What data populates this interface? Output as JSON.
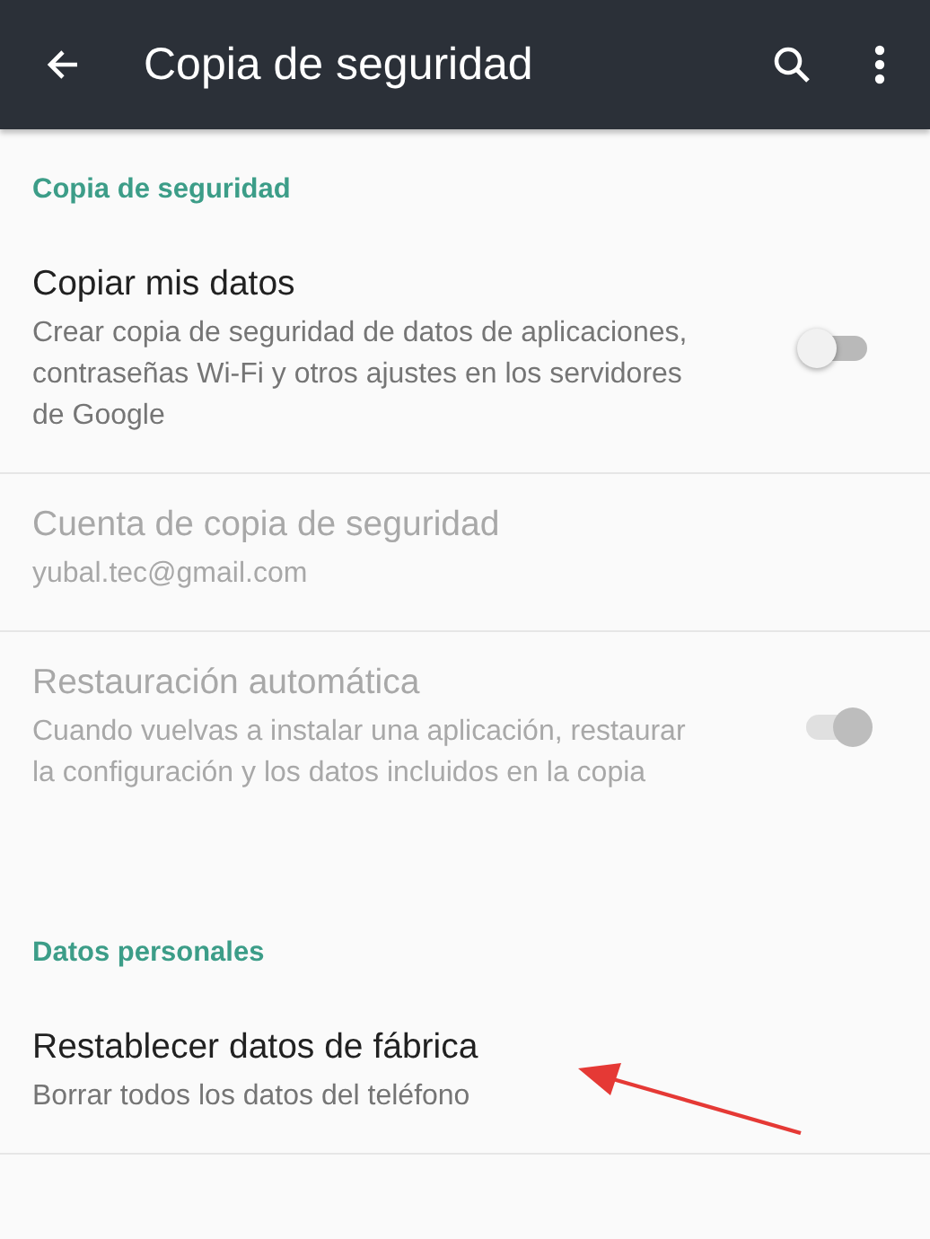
{
  "app_bar": {
    "title": "Copia de seguridad"
  },
  "sections": [
    {
      "header": "Copia de seguridad",
      "items": [
        {
          "title": "Copiar mis datos",
          "summary": "Crear copia de seguridad de datos de aplicaciones, contraseñas Wi-Fi y otros ajustes en los servidores de Google",
          "disabled": false,
          "toggle": {
            "on": false
          }
        },
        {
          "title": "Cuenta de copia de seguridad",
          "summary": "yubal.tec@gmail.com",
          "disabled": true
        },
        {
          "title": "Restauración automática",
          "summary": "Cuando vuelvas a instalar una aplicación, restaurar la configuración y los datos incluidos en la copia",
          "disabled": true,
          "toggle": {
            "on": true
          }
        }
      ]
    },
    {
      "header": "Datos personales",
      "items": [
        {
          "title": "Restablecer datos de fábrica",
          "summary": "Borrar todos los datos del teléfono",
          "disabled": false
        }
      ]
    }
  ],
  "annotation": {
    "kind": "arrow"
  }
}
